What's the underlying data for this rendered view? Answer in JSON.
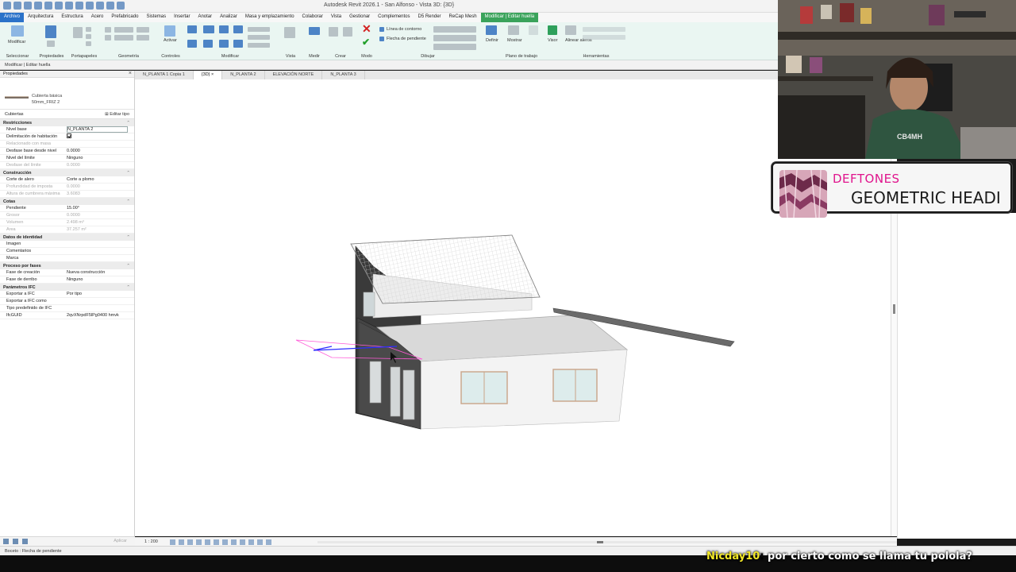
{
  "window": {
    "title": "Autodesk Revit 2026.1 - San Alfonso - Vista 3D: {3D}"
  },
  "menu": {
    "items": [
      "Archivo",
      "Arquitectura",
      "Estructura",
      "Acero",
      "Prefabricado",
      "Sistemas",
      "Insertar",
      "Anotar",
      "Analizar",
      "Masa y emplazamiento",
      "Colaborar",
      "Vista",
      "Gestionar",
      "Complementos",
      "D5 Render",
      "ReCap Mesh",
      "Modificar | Editar huella"
    ]
  },
  "ribbon": {
    "groups": [
      "Seleccionar",
      "Propiedades",
      "Portapapeles",
      "Geometría",
      "Controles",
      "Modificar",
      "Vista",
      "Medir",
      "Crear",
      "Modo",
      "Dibujar",
      "Plano de trabajo",
      "Herramientas"
    ],
    "buttons": {
      "modify": "Modificar",
      "activate": "Activar",
      "contour_lines": "Línea de contorno",
      "slope_arrow": "Flecha de pendiente",
      "define": "Definir",
      "show": "Mostrar",
      "viewer": "Visor",
      "align_eaves": "Alinear aleros"
    }
  },
  "options_bar": {
    "text": "Modificar | Editar huella"
  },
  "tabs": [
    {
      "label": "N_PLANTA 1 Copia 1",
      "active": false
    },
    {
      "label": "{3D}",
      "active": true
    },
    {
      "label": "N_PLANTA 2",
      "active": false
    },
    {
      "label": "ELEVACIÓN NORTE",
      "active": false
    },
    {
      "label": "N_PLANTA 3",
      "active": false
    }
  ],
  "properties": {
    "header": "Propiedades",
    "family": "Cubierta básica",
    "type": "50mm_FRIZ 2",
    "category_selector": "Cubiertas",
    "edit_type": "Editar tipo",
    "apply": "Aplicar",
    "sections": [
      {
        "title": "Restricciones",
        "rows": [
          {
            "k": "Nivel base",
            "v": "N_PLANTA 2",
            "boxed": true
          },
          {
            "k": "Delimitación de habitación",
            "v": "",
            "check": true
          },
          {
            "k": "Relacionado con masa",
            "v": "",
            "dim": true
          },
          {
            "k": "Desfase base desde nivel",
            "v": "0.0000"
          },
          {
            "k": "Nivel del límite",
            "v": "Ninguno"
          },
          {
            "k": "Desfase del límite",
            "v": "0.0000",
            "dim": true
          }
        ]
      },
      {
        "title": "Construcción",
        "rows": [
          {
            "k": "Corte de alero",
            "v": "Corte a plomo"
          },
          {
            "k": "Profundidad de imposta",
            "v": "0.0000",
            "dim": true
          },
          {
            "k": "Altura de cumbrera máxima",
            "v": "3.6083",
            "dim": true
          }
        ]
      },
      {
        "title": "Cotas",
        "rows": [
          {
            "k": "Pendiente",
            "v": "15.00°"
          },
          {
            "k": "Grosor",
            "v": "0.0000",
            "dim": true
          },
          {
            "k": "Volumen",
            "v": "2.498 m³",
            "dim": true
          },
          {
            "k": "Área",
            "v": "37.257 m²",
            "dim": true
          }
        ]
      },
      {
        "title": "Datos de identidad",
        "rows": [
          {
            "k": "Imagen",
            "v": ""
          },
          {
            "k": "Comentarios",
            "v": ""
          },
          {
            "k": "Marca",
            "v": ""
          }
        ]
      },
      {
        "title": "Proceso por fases",
        "rows": [
          {
            "k": "Fase de creación",
            "v": "Nueva construcción"
          },
          {
            "k": "Fase de derribo",
            "v": "Ninguno"
          }
        ]
      },
      {
        "title": "Parámetros IFC",
        "rows": [
          {
            "k": "Exportar a IFC",
            "v": "Por tipo"
          },
          {
            "k": "Exportar a IFC como",
            "v": ""
          },
          {
            "k": "Tipo predefinido de IFC",
            "v": ""
          },
          {
            "k": "IfcGUID",
            "v": "2qvXNrpdF5lPg0400 hmvk"
          }
        ]
      }
    ]
  },
  "viewbar": {
    "scale": "1 : 200"
  },
  "status": {
    "text": "Boceto : Flecha de pendiente"
  },
  "now_playing": {
    "artist": "DEFTONES",
    "song": "GEOMETRIC HEADI"
  },
  "chat": {
    "user": "Nicday10",
    "message": "por cierto como se llama tu polola?"
  },
  "webcam": {
    "shirt_text": "CB4MH"
  }
}
